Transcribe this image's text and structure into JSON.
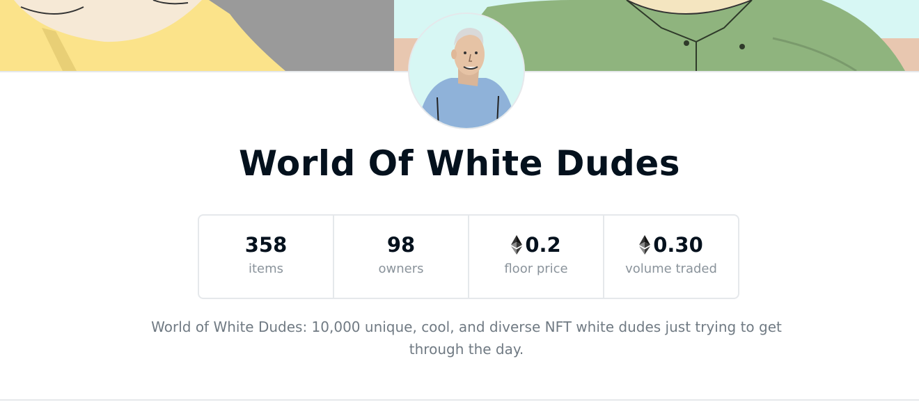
{
  "collection": {
    "name": "World Of White Dudes",
    "description": "World of White Dudes: 10,000 unique, cool, and diverse NFT white dudes just trying to get through the day."
  },
  "stats": [
    {
      "value": "358",
      "label": "items",
      "currency_icon": null
    },
    {
      "value": "98",
      "label": "owners",
      "currency_icon": null
    },
    {
      "value": "0.2",
      "label": "floor price",
      "currency_icon": "ethereum-icon"
    },
    {
      "value": "0.30",
      "label": "volume traded",
      "currency_icon": "ethereum-icon"
    }
  ],
  "colors": {
    "title": "#04111d",
    "label": "#8a939b",
    "description": "#707a83",
    "border": "#e5e8eb",
    "banner_yellow": "#fbe38a",
    "banner_gray": "#9a9a9a",
    "banner_cyan": "#d7f7f4",
    "banner_green": "#8fb47e",
    "avatar_shirt": "#8fb2d9"
  }
}
